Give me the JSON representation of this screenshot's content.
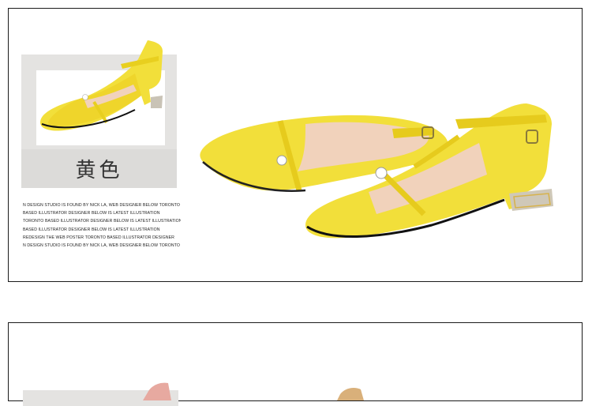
{
  "color_label": "黄色",
  "description_lines": [
    "N DESIGN STUDIO IS FOUND BY NICK LA, WEB DESIGNER BELOW TORONTO",
    "BASED ILLUSTRATOR DESIGNER BELOW IS LATEST ILLUSTRATION",
    "TORONTO BASED ILLUSTRATOR DESIGNER BELOW IS LATEST ILLUSTRATION",
    "BASED ILLUSTRATOR DESIGNER BELOW IS LATEST ILLUSTRATION",
    "REDESIGN THE WEB POSTER TORONTO BASED ILLUSTRATOR DESIGNER",
    "N DESIGN STUDIO IS FOUND BY NICK LA, WEB DESIGNER BELOW TORONTO"
  ],
  "colors": {
    "shoe_yellow": "#f2df3a",
    "shoe_shade": "#d9c21e",
    "lining": "#f1d2bb",
    "pink_shoe": "#e7a9a0"
  },
  "icons": [
    "rhinestone-icon",
    "buckle-icon"
  ]
}
